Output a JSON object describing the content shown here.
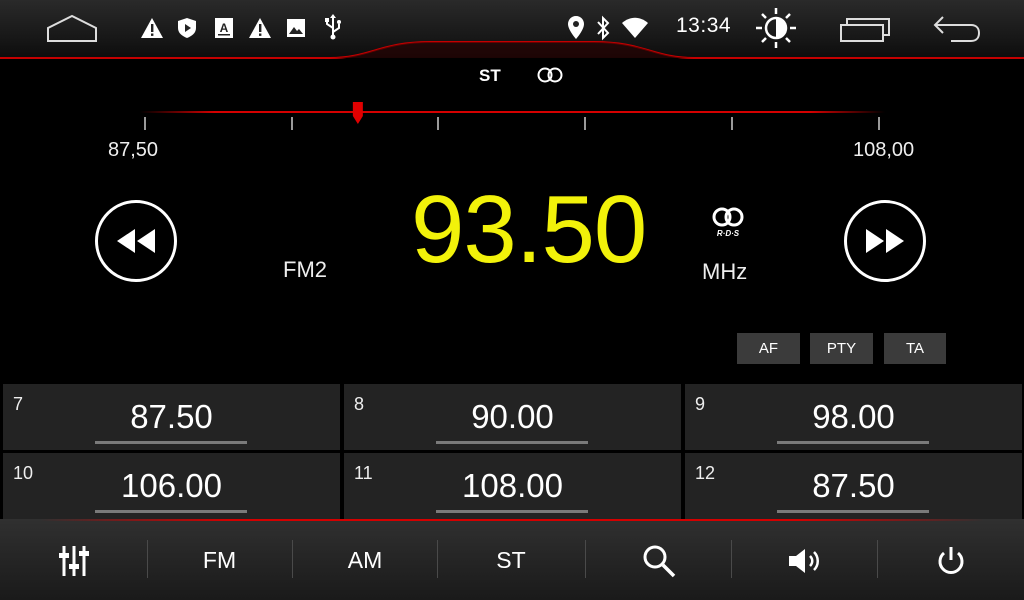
{
  "status_bar": {
    "time": "13:34",
    "icons": [
      "home-icon",
      "warning-icon",
      "shield-play-icon",
      "font-a-icon",
      "warning-icon",
      "image-icon",
      "usb-icon",
      "location-pin-icon",
      "bluetooth-icon",
      "wifi-icon",
      "brightness-icon",
      "recent-apps-icon",
      "back-icon"
    ]
  },
  "tuner": {
    "stereo_label": "ST",
    "scale_min": "87,50",
    "scale_max": "108,00",
    "scale_position": 0.29,
    "frequency": "93.50",
    "band": "FM2",
    "unit": "MHz",
    "rds_label": "R·D·S",
    "buttons": {
      "af": "AF",
      "pty": "PTY",
      "ta": "TA"
    }
  },
  "presets": [
    {
      "number": "7",
      "freq": "87.50"
    },
    {
      "number": "8",
      "freq": "90.00"
    },
    {
      "number": "9",
      "freq": "98.00"
    },
    {
      "number": "10",
      "freq": "106.00"
    },
    {
      "number": "11",
      "freq": "108.00"
    },
    {
      "number": "12",
      "freq": "87.50"
    }
  ],
  "bottom_bar": {
    "fm": "FM",
    "am": "AM",
    "st": "ST",
    "icons": [
      "equalizer-icon",
      "search-icon",
      "volume-icon",
      "power-icon"
    ]
  },
  "colors": {
    "accent": "#f2f20a",
    "red": "#d40000"
  }
}
